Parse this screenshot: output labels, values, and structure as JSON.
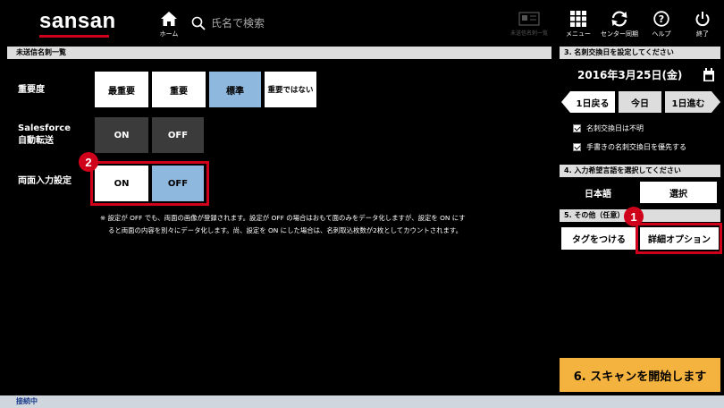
{
  "app": {
    "logo": "sansan",
    "brand_color": "#d0021b"
  },
  "nav": {
    "home_label": "ホーム",
    "search_placeholder": "氏名で検索",
    "unsent_label": "未送信名刺一覧",
    "menu_label": "メニュー",
    "sync_label": "センター同期",
    "help_label": "ヘルプ",
    "exit_label": "終了"
  },
  "left": {
    "header": "未送信名刺一覧",
    "importance": {
      "label": "重要度",
      "options": [
        "最重要",
        "重要",
        "標準",
        "重要ではない"
      ],
      "selected": "標準"
    },
    "salesforce": {
      "label_line1": "Salesforce",
      "label_line2": "自動転送",
      "on": "ON",
      "off": "OFF"
    },
    "duplex": {
      "label": "両面入力設定",
      "on": "ON",
      "off": "OFF",
      "selected": "OFF"
    },
    "note_line1": "※ 設定が OFF でも、両面の画像が登録されます。設定が OFF の場合はおもて面のみをデータ化しますが、設定を ON にす",
    "note_line2": "ると両面の内容を別々にデータ化します。尚、設定を ON にした場合は、名刺取込枚数が2枚としてカウントされます。"
  },
  "right": {
    "section3_header": "3. 名刺交換日を設定してください",
    "date": "2016年3月25日(金)",
    "prev_day": "1日戻る",
    "today": "今日",
    "next_day": "1日進む",
    "check_unknown": "名刺交換日は不明",
    "check_handwritten": "手書きの名刺交換日を優先する",
    "section4_header": "4. 入力希望言語を選択してください",
    "language": "日本語",
    "select_label": "選択",
    "section5_header": "5. その他（任意）",
    "tag_button": "タグをつける",
    "detail_button": "詳細オプション",
    "scan_button": "6. スキャンを開始します"
  },
  "annotations": {
    "badge1": "1",
    "badge2": "2"
  },
  "status": {
    "text": "接続中"
  }
}
